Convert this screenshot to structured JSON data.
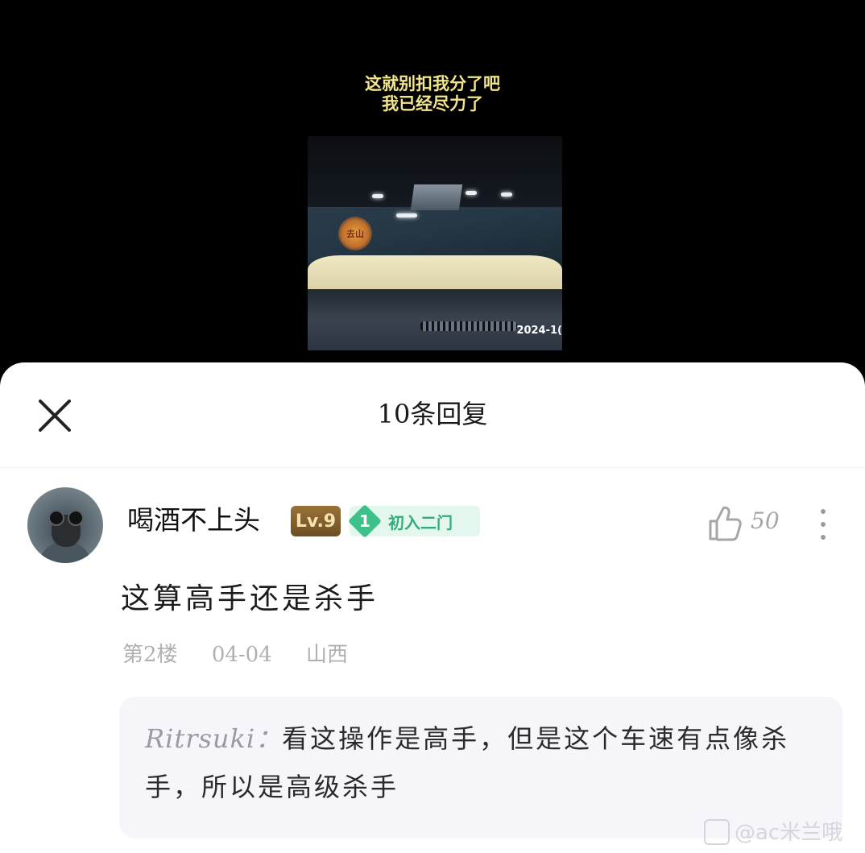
{
  "video": {
    "caption_line1": "这就别扣我分了吧",
    "caption_line2": "我已经尽力了",
    "timestamp": "2024-1(",
    "badge_text": "去山"
  },
  "sheet": {
    "title": "10条回复",
    "close_icon": "close-icon"
  },
  "comment": {
    "username": "喝酒不上头",
    "level": "Lv.9",
    "rank_number": "1",
    "rank_label": "初入二门",
    "like_count": "50",
    "text": "这算高手还是杀手",
    "floor": "第2楼",
    "date": "04-04",
    "location": "山西"
  },
  "reply": {
    "author": "Ritrsuki：",
    "text": "看这操作是高手，但是这个车速有点像杀手，所以是高级杀手"
  },
  "watermark": {
    "text": "@ac米兰哦"
  },
  "colors": {
    "caption": "#f2e58a",
    "level_badge": "#8a6430",
    "rank_green": "#3ec08a",
    "reply_bg": "#f6f5fa"
  }
}
